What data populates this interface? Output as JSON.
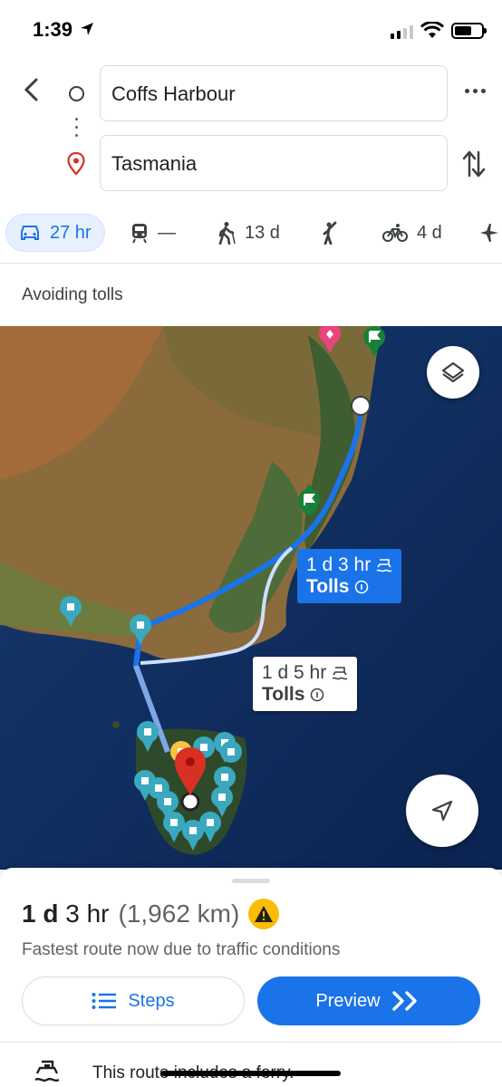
{
  "status": {
    "time": "1:39"
  },
  "directions": {
    "origin": "Coffs Harbour",
    "destination": "Tasmania"
  },
  "modes": [
    {
      "name": "drive",
      "label": "27 hr",
      "active": true
    },
    {
      "name": "transit",
      "label": "—"
    },
    {
      "name": "walk",
      "label": "13 d"
    },
    {
      "name": "ride-hail",
      "label": ""
    },
    {
      "name": "cycle",
      "label": "4 d"
    },
    {
      "name": "flight",
      "label": ""
    }
  ],
  "preferences": {
    "avoid_text": "Avoiding tolls"
  },
  "map": {
    "route_primary": {
      "time": "1 d 3 hr",
      "tolls": "Tolls"
    },
    "route_alt": {
      "time": "1 d 5 hr",
      "tolls": "Tolls"
    }
  },
  "summary": {
    "time_d": "1 d",
    "time_h": "3 hr",
    "distance": "(1,962 km)",
    "subtitle": "Fastest route now due to traffic conditions",
    "steps_label": "Steps",
    "preview_label": "Preview",
    "ferry_notice": "This route includes a ferry."
  },
  "colors": {
    "accent": "#1a73e8",
    "warning": "#fbbc04",
    "destination_pin": "#d93025"
  }
}
